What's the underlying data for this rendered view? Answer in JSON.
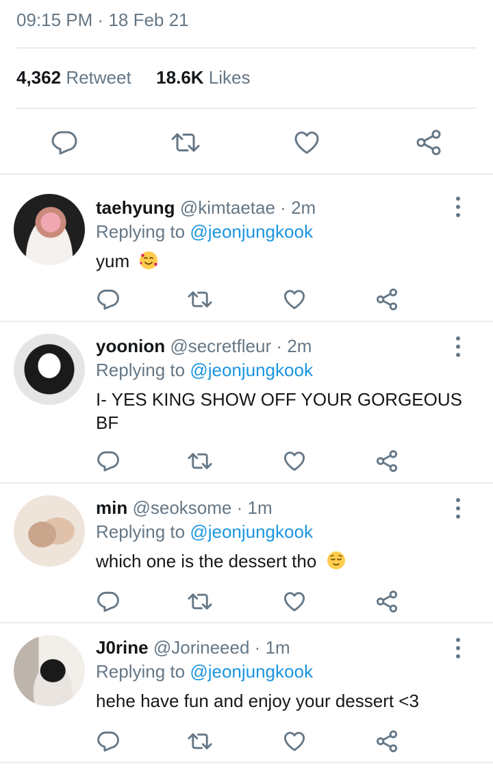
{
  "tweet": {
    "time": "09:15 PM",
    "sep": "·",
    "date": "18 Feb 21",
    "retweets_count": "4,362",
    "retweets_label": "Retweet",
    "likes_count": "18.6K",
    "likes_label": "Likes"
  },
  "actions": {
    "reply_icon": "reply-icon",
    "retweet_icon": "retweet-icon",
    "like_icon": "heart-icon",
    "share_icon": "share-icon"
  },
  "replies": [
    {
      "name": "taehyung",
      "handle": "@kimtaetae",
      "sep": "·",
      "time": "2m",
      "replying_label": "Replying to",
      "replying_to": "@jeonjungkook",
      "text": "yum",
      "emoji": "smiling-face-with-hearts-emoji",
      "avatar_color": "#2a2a2a"
    },
    {
      "name": "yoonion",
      "handle": "@secretfleur",
      "sep": "·",
      "time": "2m",
      "replying_label": "Replying to",
      "replying_to": "@jeonjungkook",
      "text": "I- YES KING SHOW OFF YOUR GORGEOUS BF",
      "emoji": "",
      "avatar_color": "#e8e8e8"
    },
    {
      "name": "min",
      "handle": "@seoksome",
      "sep": "·",
      "time": "1m",
      "replying_label": "Replying to",
      "replying_to": "@jeonjungkook",
      "text": "which one is the dessert tho",
      "emoji": "relieved-face-emoji",
      "avatar_color": "#d9c2b0"
    },
    {
      "name": "J0rine",
      "handle": "@Jorineeed",
      "sep": "·",
      "time": "1m",
      "replying_label": "Replying to",
      "replying_to": "@jeonjungkook",
      "text": "hehe have fun and enjoy your dessert <3",
      "emoji": "",
      "avatar_color": "#cfc7c0"
    }
  ],
  "colors": {
    "link": "#1b95e0",
    "secondary": "#657786",
    "divider": "#e6ecf0"
  }
}
